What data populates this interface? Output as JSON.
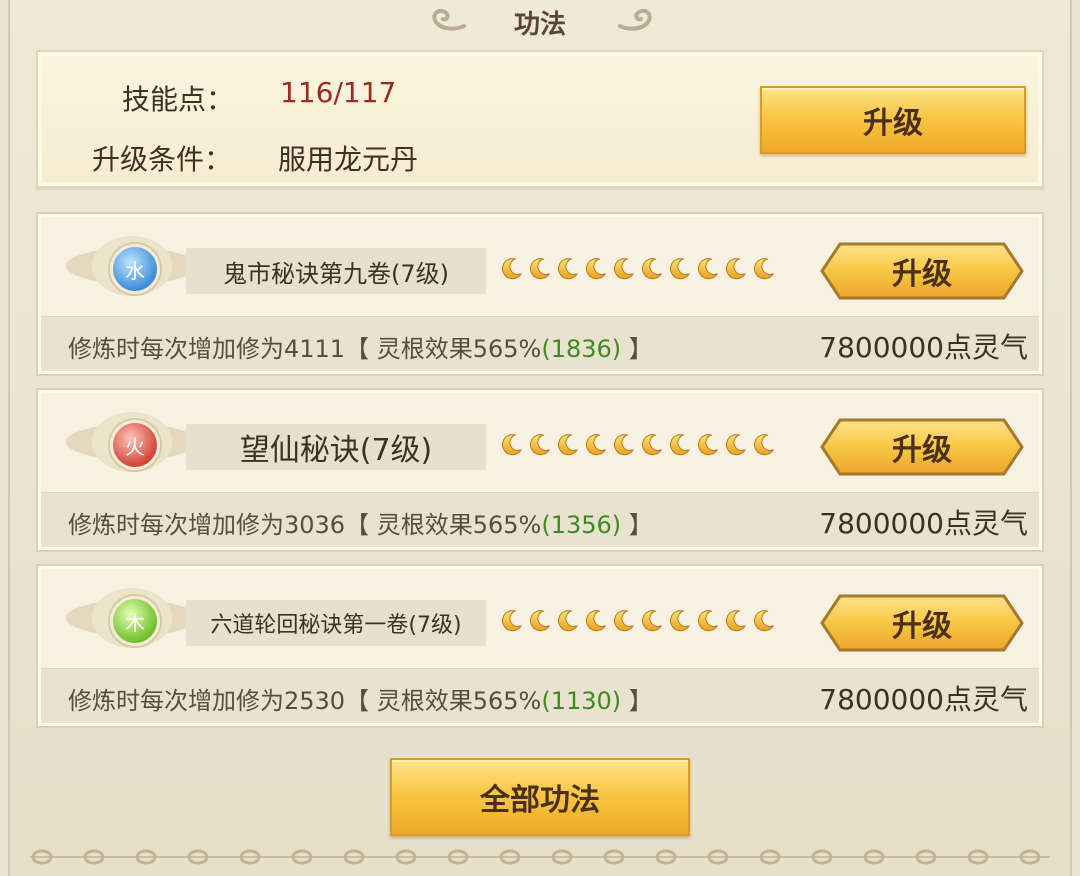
{
  "header": {
    "title": "功法"
  },
  "skill_points": {
    "label": "技能点：",
    "value": "116/117",
    "condition_label": "升级条件：",
    "condition_value": "服用龙元丹",
    "upgrade_label": "升级"
  },
  "techniques": [
    {
      "element": "水",
      "element_icon": "water-orb-icon",
      "name": "鬼市秘诀第九卷(7级)",
      "moons": 10,
      "desc_prefix": "修炼时每次增加修为4111【 灵根效果565%",
      "desc_bonus": "(1836)",
      "desc_suffix": " 】",
      "cost": "7800000点灵气",
      "upgrade_label": "升级"
    },
    {
      "element": "火",
      "element_icon": "fire-orb-icon",
      "name": "望仙秘诀(7级)",
      "moons": 10,
      "desc_prefix": "修炼时每次增加修为3036【 灵根效果565%",
      "desc_bonus": "(1356)",
      "desc_suffix": " 】",
      "cost": "7800000点灵气",
      "upgrade_label": "升级"
    },
    {
      "element": "木",
      "element_icon": "wood-orb-icon",
      "name": "六道轮回秘诀第一卷(7级)",
      "moons": 10,
      "desc_prefix": "修炼时每次增加修为2530【 灵根效果565%",
      "desc_bonus": "(1130)",
      "desc_suffix": " 】",
      "cost": "7800000点灵气",
      "upgrade_label": "升级"
    }
  ],
  "footer": {
    "all_techniques_label": "全部功法"
  },
  "colors": {
    "skill_value": "#9b2a22",
    "bonus_green": "#3f8a22",
    "button_gold": "#f8c743"
  }
}
